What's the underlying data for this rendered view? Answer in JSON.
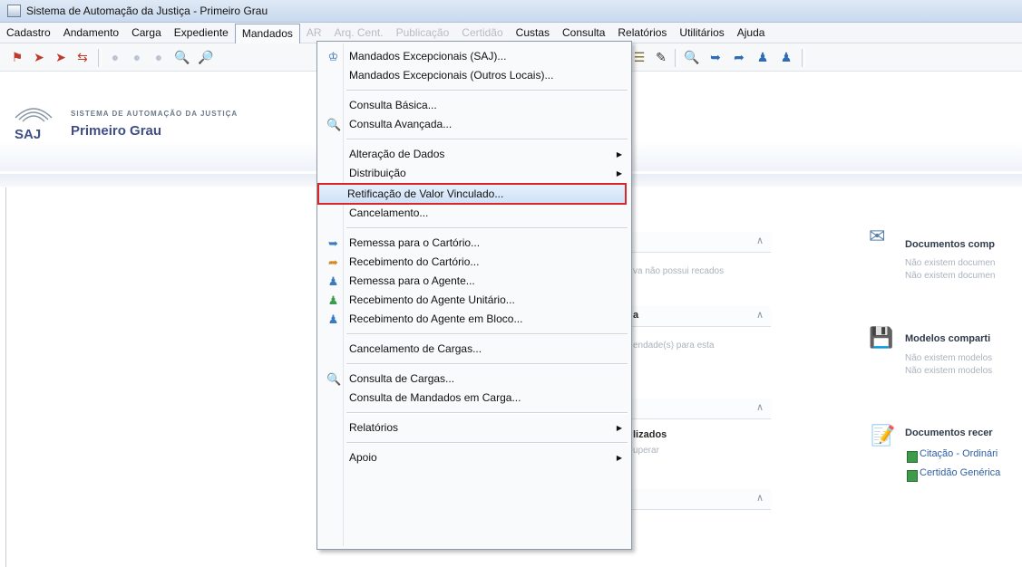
{
  "window": {
    "title": "Sistema de Automação da Justiça - Primeiro Grau"
  },
  "menubar": [
    {
      "label": "Cadastro",
      "disabled": false
    },
    {
      "label": "Andamento",
      "disabled": false
    },
    {
      "label": "Carga",
      "disabled": false
    },
    {
      "label": "Expediente",
      "disabled": false
    },
    {
      "label": "Mandados",
      "disabled": false,
      "open": true
    },
    {
      "label": "AR",
      "disabled": true
    },
    {
      "label": "Arq. Cent.",
      "disabled": true
    },
    {
      "label": "Publicação",
      "disabled": true
    },
    {
      "label": "Certidão",
      "disabled": true
    },
    {
      "label": "Custas",
      "disabled": false
    },
    {
      "label": "Consulta",
      "disabled": false
    },
    {
      "label": "Relatórios",
      "disabled": false
    },
    {
      "label": "Utilitários",
      "disabled": false
    },
    {
      "label": "Ajuda",
      "disabled": false
    }
  ],
  "banner": {
    "small": "SISTEMA DE AUTOMAÇÃO DA JUSTIÇA",
    "logo_text": "SAJ",
    "main": "Primeiro Grau",
    "accent": "#3e4f86"
  },
  "dropdown": {
    "items": [
      {
        "label": "Mandados Excepcionais (SAJ)...",
        "icon": "mandados-icon"
      },
      {
        "label": "Mandados Excepcionais (Outros Locais)..."
      },
      {
        "label": "Consulta Básica..."
      },
      {
        "label": "Consulta Avançada...",
        "icon": "search-icon"
      },
      {
        "label": "Alteração de Dados",
        "submenu": true
      },
      {
        "label": "Distribuição",
        "submenu": true
      },
      {
        "label": "Retificação de Valor Vinculado...",
        "highlight": true
      },
      {
        "label": "Cancelamento..."
      },
      {
        "label": "Remessa para o Cartório...",
        "icon": "send-icon"
      },
      {
        "label": "Recebimento do Cartório...",
        "icon": "receive-icon"
      },
      {
        "label": "Remessa para o Agente...",
        "icon": "agent-send-icon"
      },
      {
        "label": "Recebimento do Agente Unitário...",
        "icon": "agent-receive-icon"
      },
      {
        "label": "Recebimento do Agente em Bloco...",
        "icon": "agent-block-icon"
      },
      {
        "label": "Cancelamento de Cargas..."
      },
      {
        "label": "Consulta de Cargas...",
        "icon": "cargo-search-icon"
      },
      {
        "label": "Consulta de Mandados em Carga..."
      },
      {
        "label": "Relatórios",
        "submenu": true
      },
      {
        "label": "Apoio",
        "submenu": true
      }
    ],
    "highlight_color": "#d8262b"
  },
  "panels": {
    "p1_text": "va não possui recados",
    "p2_title": "a",
    "p2_text": "endade(s) para esta",
    "p3_title": "lizados",
    "p3_text": "uperar"
  },
  "right": {
    "docs_title": "Documentos comp",
    "docs_sub1": "Não existem documen",
    "docs_sub2": "Não existem documen",
    "models_title": "Modelos comparti",
    "models_sub1": "Não existem modelos",
    "models_sub2": "Não existem modelos",
    "recent_title": "Documentos recer",
    "recent_link1": "Citação - Ordinári",
    "recent_link2": "Certidão Genérica"
  }
}
